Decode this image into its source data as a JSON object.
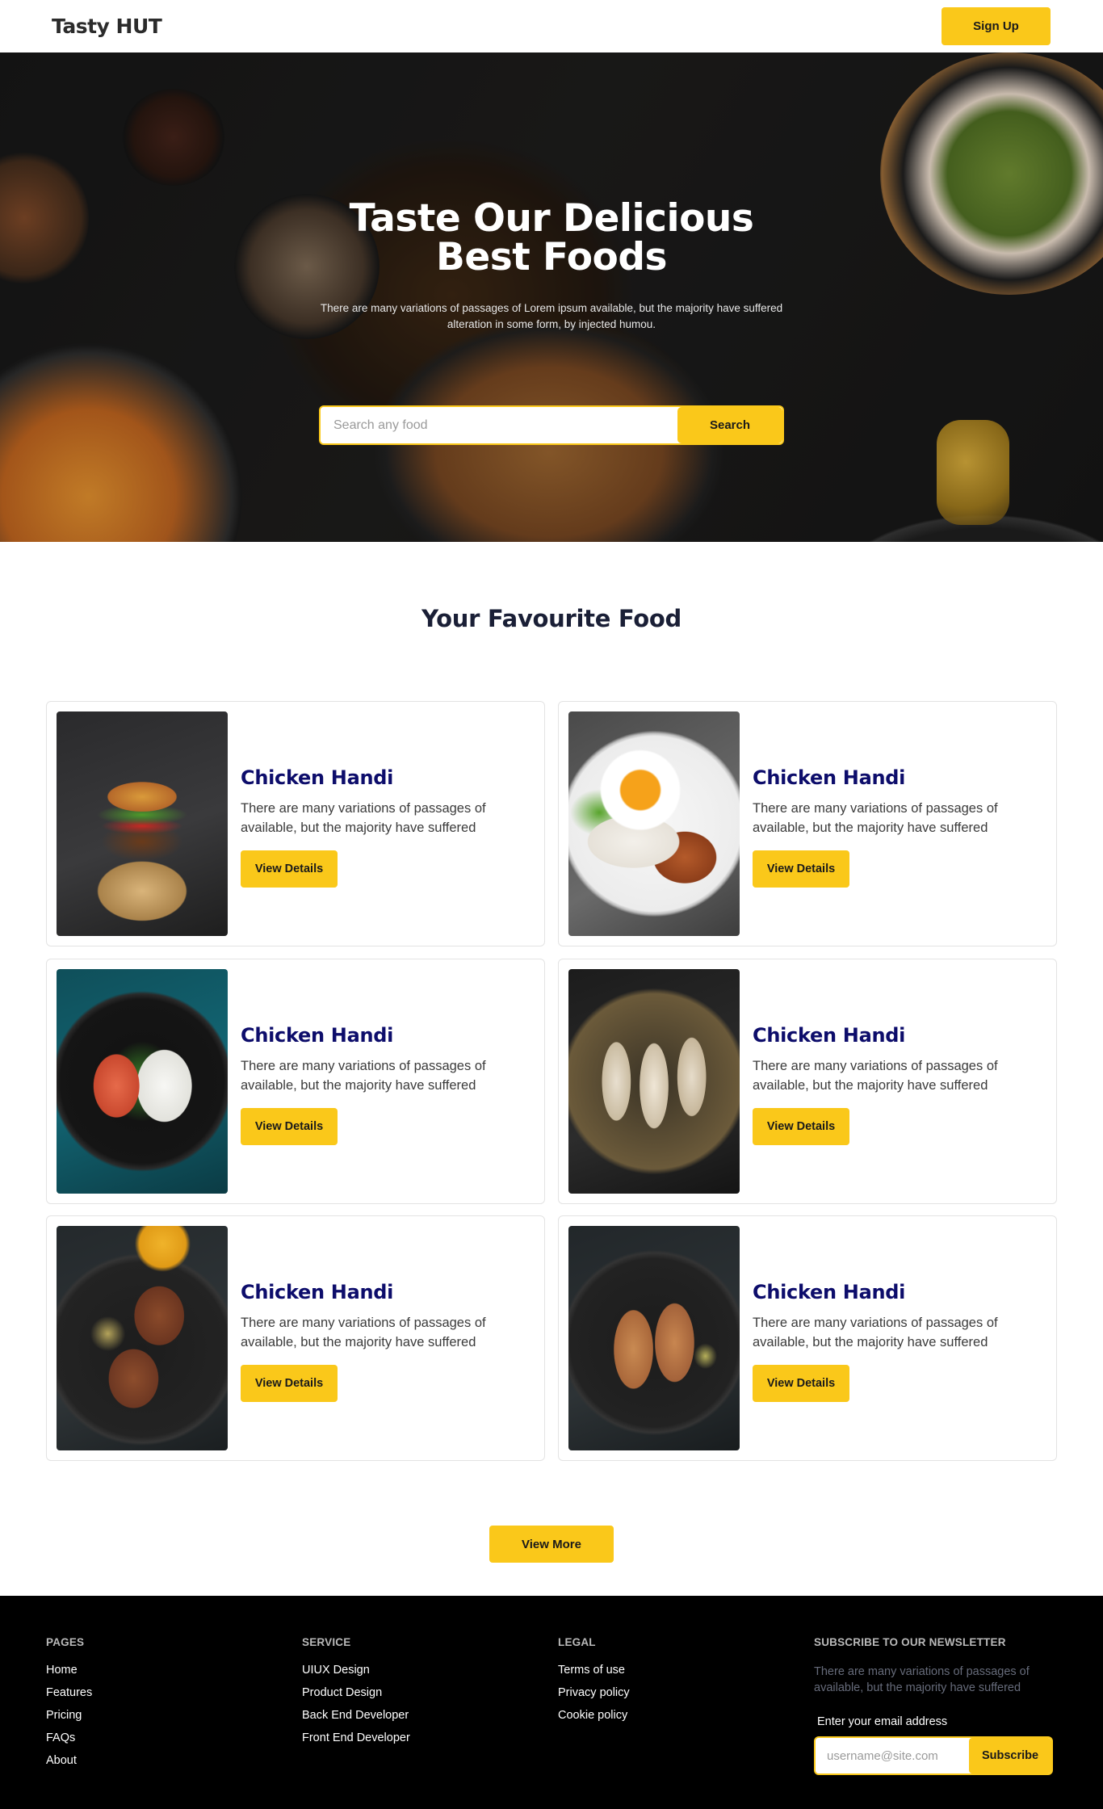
{
  "nav": {
    "brand": "Tasty HUT",
    "signup_label": "Sign Up"
  },
  "hero": {
    "title_line1": "Taste Our Delicious",
    "title_line2": "Best Foods",
    "subtitle": "There are many variations of passages of Lorem ipsum available, but the majority have suffered alteration in some form, by injected humou.",
    "search_placeholder": "Search any food",
    "search_button": "Search"
  },
  "section": {
    "title": "Your Favourite Food"
  },
  "cards": [
    {
      "title": "Chicken Handi",
      "description": "There are many variations of passages of available, but the majority have suffered",
      "button": "View Details"
    },
    {
      "title": "Chicken Handi",
      "description": "There are many variations of passages of available, but the majority have suffered",
      "button": "View Details"
    },
    {
      "title": "Chicken Handi",
      "description": "There are many variations of passages of available, but the majority have suffered",
      "button": "View Details"
    },
    {
      "title": "Chicken Handi",
      "description": "There are many variations of passages of available, but the majority have suffered",
      "button": "View Details"
    },
    {
      "title": "Chicken Handi",
      "description": "There are many variations of passages of available, but the majority have suffered",
      "button": "View Details"
    },
    {
      "title": "Chicken Handi",
      "description": "There are many variations of passages of available, but the majority have suffered",
      "button": "View Details"
    }
  ],
  "view_more": "View More",
  "footer": {
    "pages": {
      "heading": "PAGES",
      "links": [
        "Home",
        "Features",
        "Pricing",
        "FAQs",
        "About"
      ]
    },
    "service": {
      "heading": "SERVICE",
      "links": [
        "UIUX Design",
        "Product Design",
        "Back End Developer",
        "Front End Developer"
      ]
    },
    "legal": {
      "heading": "LEGAL",
      "links": [
        "Terms of use",
        "Privacy policy",
        "Cookie policy"
      ]
    },
    "newsletter": {
      "heading": "SUBSCRIBE TO OUR NEWSLETTER",
      "text": "There are many variations of passages of available, but the majority have suffered",
      "email_label": "Enter your email address",
      "email_placeholder": "username@site.com",
      "subscribe_button": "Subscribe"
    }
  },
  "colors": {
    "accent": "#fac81a",
    "card_title": "#0d0d6b",
    "footer_bg": "#000000"
  }
}
